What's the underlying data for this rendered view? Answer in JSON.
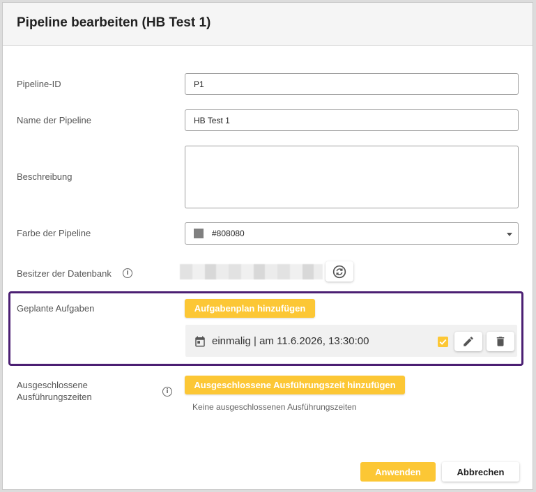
{
  "dialog": {
    "title": "Pipeline bearbeiten (HB Test 1)"
  },
  "fields": {
    "pipeline_id": {
      "label": "Pipeline-ID",
      "value": "P1"
    },
    "name": {
      "label": "Name der Pipeline",
      "value": "HB Test 1"
    },
    "description": {
      "label": "Beschreibung",
      "value": ""
    },
    "color": {
      "label": "Farbe der Pipeline",
      "value": "#808080",
      "swatch": "#808080"
    },
    "owner": {
      "label": "Besitzer der Datenbank"
    }
  },
  "scheduled": {
    "label": "Geplante Aufgaben",
    "add_button": "Aufgabenplan hinzufügen",
    "task_text": "einmalig | am 11.6.2026, 13:30:00"
  },
  "excluded": {
    "label_line1": "Ausgeschlossene",
    "label_line2": "Ausführungszeiten",
    "add_button": "Ausgeschlossene Ausführungszeit hinzufügen",
    "empty_text": "Keine ausgeschlossenen Ausführungszeiten"
  },
  "footer": {
    "apply": "Anwenden",
    "cancel": "Abbrechen"
  },
  "colors": {
    "accent": "#fcc735",
    "highlight": "#4b1f73"
  }
}
